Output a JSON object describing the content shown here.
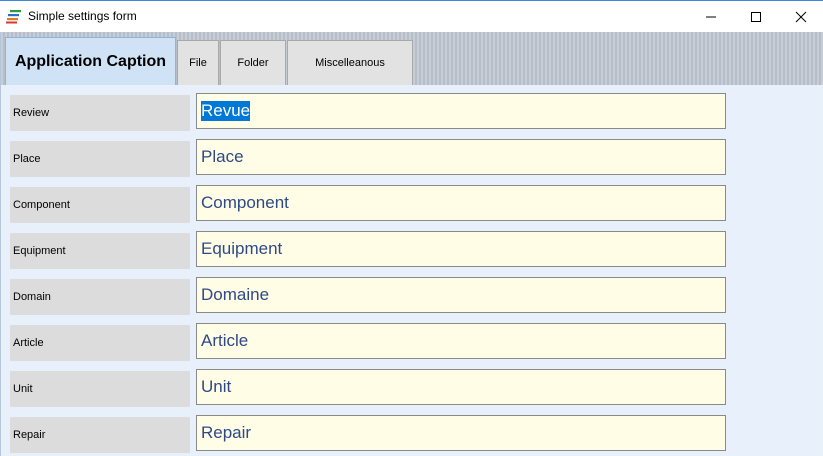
{
  "window": {
    "title": "Simple settings form",
    "icon": "stacked-lines-app-icon",
    "controls": [
      "minimize-icon",
      "maximize-icon",
      "close-icon"
    ]
  },
  "tabs": [
    {
      "label": "Application Caption",
      "active": true
    },
    {
      "label": "File",
      "active": false
    },
    {
      "label": "Folder",
      "active": false
    },
    {
      "label": "Miscelleanous",
      "active": false
    }
  ],
  "fields": [
    {
      "label": "Review",
      "value": "Revue",
      "selected": true
    },
    {
      "label": "Place",
      "value": "Place"
    },
    {
      "label": "Component",
      "value": "Component"
    },
    {
      "label": "Equipment",
      "value": "Equipment"
    },
    {
      "label": "Domain",
      "value": "Domaine"
    },
    {
      "label": "Article",
      "value": "Article"
    },
    {
      "label": "Unit",
      "value": "Unit"
    },
    {
      "label": "Repair",
      "value": "Repair"
    }
  ],
  "colors": {
    "input_background": "#fffde6",
    "input_text": "#2e4a86",
    "active_tab": "#cfe2f6",
    "selection": "#0078d7"
  }
}
